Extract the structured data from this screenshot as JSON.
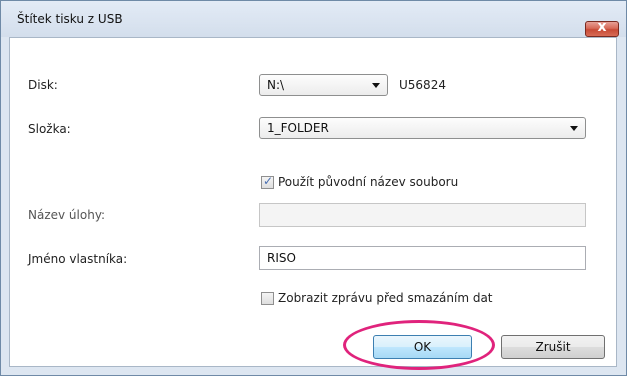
{
  "dialog": {
    "title": "Štítek tisku z USB",
    "close_label": "x"
  },
  "form": {
    "disk_label": "Disk:",
    "disk_value": "N:\\",
    "disk_id": "U56824",
    "folder_label": "Složka:",
    "folder_value": "1_FOLDER",
    "use_original_name_label": "Použít původní název souboru",
    "use_original_name_checked": true,
    "job_name_label": "Název úlohy:",
    "job_name_value": "",
    "owner_label": "Jméno vlastníka:",
    "owner_value": "RISO",
    "show_message_label": "Zobrazit zprávu před smazáním dat",
    "show_message_checked": false
  },
  "buttons": {
    "ok": "OK",
    "cancel": "Zrušit"
  },
  "colors": {
    "highlight": "#e0237c",
    "close_button": "#c74a36"
  }
}
